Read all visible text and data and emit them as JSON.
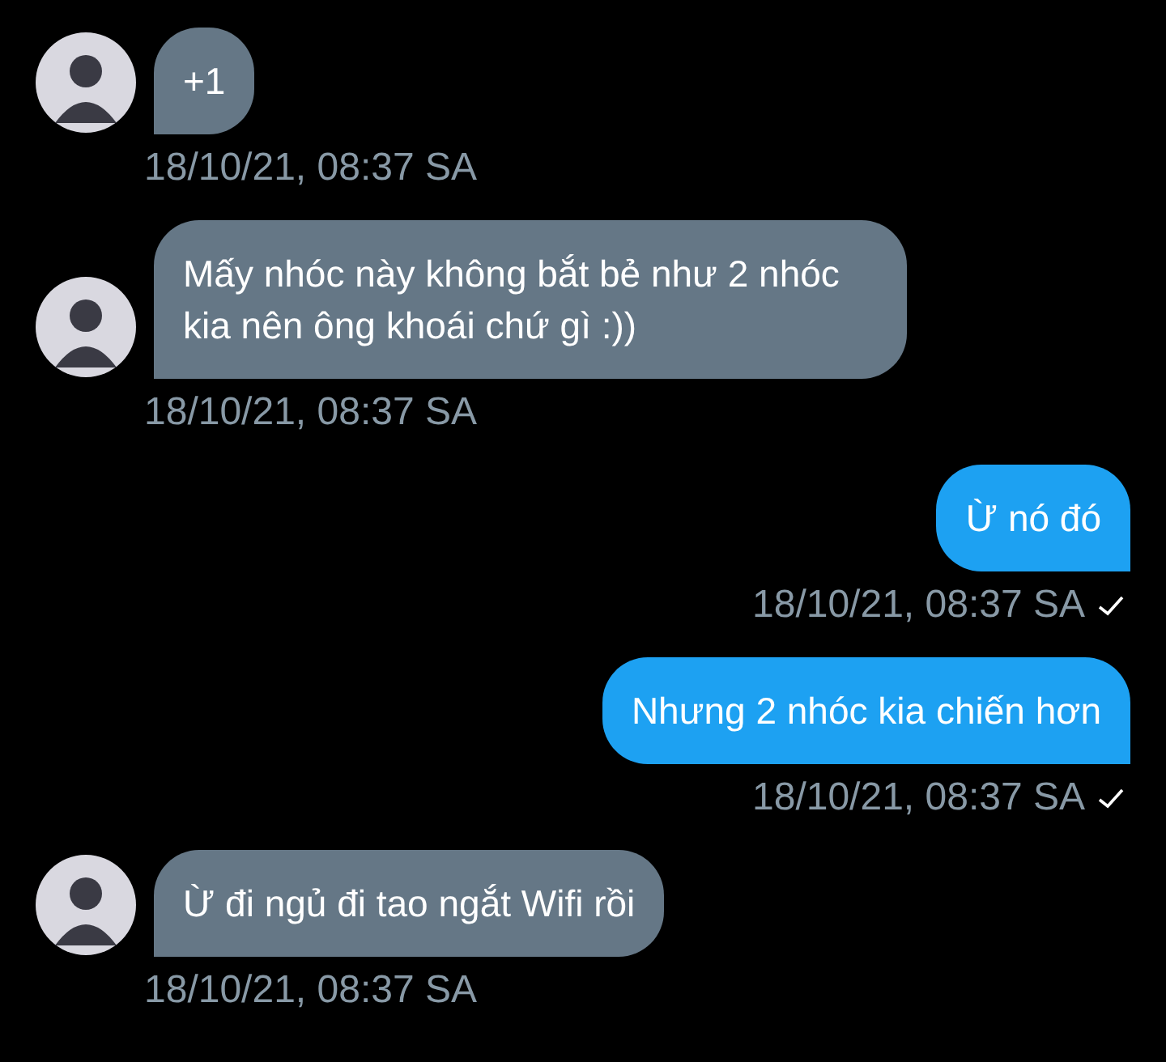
{
  "messages": [
    {
      "kind": "incoming",
      "text": "+1",
      "time": "18/10/21, 08:37 SA"
    },
    {
      "kind": "incoming",
      "text": "Mấy nhóc này không bắt bẻ như 2 nhóc kia nên ông khoái chứ gì :))",
      "time": "18/10/21, 08:37 SA"
    },
    {
      "kind": "outgoing",
      "text": "Ừ nó đó",
      "time": "18/10/21, 08:37 SA"
    },
    {
      "kind": "outgoing",
      "text": "Nhưng 2 nhóc kia chiến hơn",
      "time": "18/10/21, 08:37 SA"
    },
    {
      "kind": "incoming",
      "text": "Ừ đi ngủ đi tao ngắt Wifi rồi",
      "time": "18/10/21, 08:37 SA"
    }
  ]
}
